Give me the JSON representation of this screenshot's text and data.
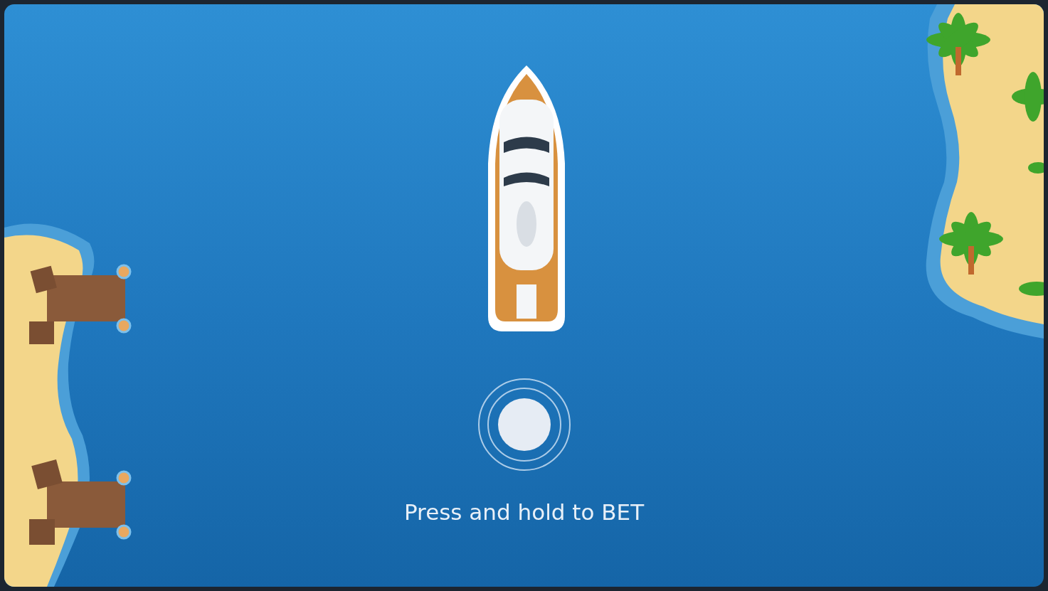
{
  "prompt": {
    "text": "Press and hold to BET"
  }
}
